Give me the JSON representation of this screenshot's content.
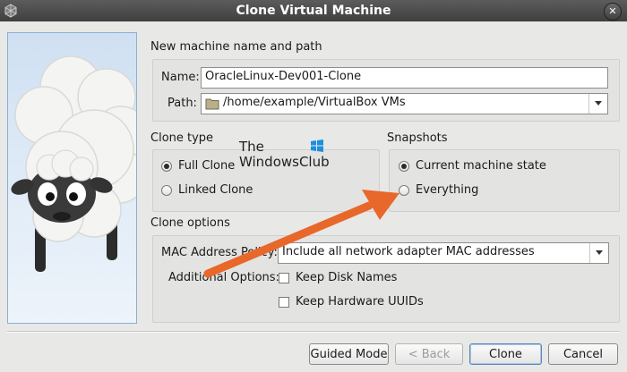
{
  "window": {
    "title": "Clone Virtual Machine",
    "close_glyph": "✕"
  },
  "name_path": {
    "heading": "New machine name and path",
    "name_label": "Name:",
    "name_value": "OracleLinux-Dev001-Clone",
    "path_label": "Path:",
    "path_value": "/home/example/VirtualBox VMs"
  },
  "clone_type": {
    "heading": "Clone type",
    "options": [
      {
        "label": "Full Clone",
        "selected": true
      },
      {
        "label": "Linked Clone",
        "selected": false
      }
    ]
  },
  "snapshots": {
    "heading": "Snapshots",
    "options": [
      {
        "label": "Current machine state",
        "selected": true
      },
      {
        "label": "Everything",
        "selected": false
      }
    ]
  },
  "clone_options": {
    "heading": "Clone options",
    "mac_label": "MAC Address Policy:",
    "mac_value": "Include all network adapter MAC addresses",
    "additional_label": "Additional Options:",
    "keep_disk_names": "Keep Disk Names",
    "keep_hardware_uuids": "Keep Hardware UUIDs"
  },
  "buttons": {
    "guided_mode": "Guided Mode",
    "back": "< Back",
    "clone": "Clone",
    "cancel": "Cancel"
  },
  "watermark": {
    "line1": "The",
    "line2": "WindowsClub"
  },
  "colors": {
    "accent_arrow": "#e8672a",
    "titlebar": "#4a4a4a"
  },
  "icons": {
    "window": "virtualbox-icon",
    "path": "folder-icon",
    "wizard": "sheep-mascot"
  }
}
